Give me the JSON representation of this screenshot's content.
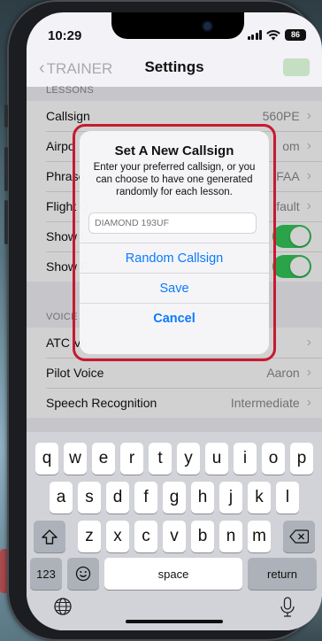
{
  "status": {
    "time": "10:29",
    "battery": "86"
  },
  "nav": {
    "back_label": "TRAINER",
    "title": "Settings"
  },
  "lessons": {
    "header": "LESSONS",
    "rows": [
      {
        "label": "Callsign",
        "value": "560PE"
      },
      {
        "label": "Airpo",
        "value": "om"
      },
      {
        "label": "Phrase",
        "value": "FAA"
      },
      {
        "label": "Flight D",
        "value": "fault"
      },
      {
        "label": "Show L",
        "toggle": true
      },
      {
        "label": "Show F",
        "toggle": true
      }
    ]
  },
  "voice": {
    "header": "VOICE",
    "rows": [
      {
        "label": "ATC Vo",
        "value": ""
      },
      {
        "label": "Pilot Voice",
        "value": "Aaron"
      },
      {
        "label": "Speech Recognition",
        "value": "Intermediate"
      }
    ]
  },
  "alert": {
    "title": "Set A New Callsign",
    "message": "Enter your preferred callsign, or you can choose to have one generated randomly for each lesson.",
    "input_placeholder": "DIAMOND 193UF",
    "random_label": "Random Callsign",
    "save_label": "Save",
    "cancel_label": "Cancel",
    "highlight_color": "#c8192f"
  },
  "keyboard": {
    "row1": [
      "q",
      "w",
      "e",
      "r",
      "t",
      "y",
      "u",
      "i",
      "o",
      "p"
    ],
    "row2": [
      "a",
      "s",
      "d",
      "f",
      "g",
      "h",
      "j",
      "k",
      "l"
    ],
    "row3": [
      "z",
      "x",
      "c",
      "v",
      "b",
      "n",
      "m"
    ],
    "numbers_label": "123",
    "space_label": "space",
    "return_label": "return",
    "icons": {
      "shift": "shift-icon",
      "delete": "delete-icon",
      "emoji": "emoji-icon",
      "globe": "globe-icon",
      "mic": "microphone-icon"
    }
  }
}
